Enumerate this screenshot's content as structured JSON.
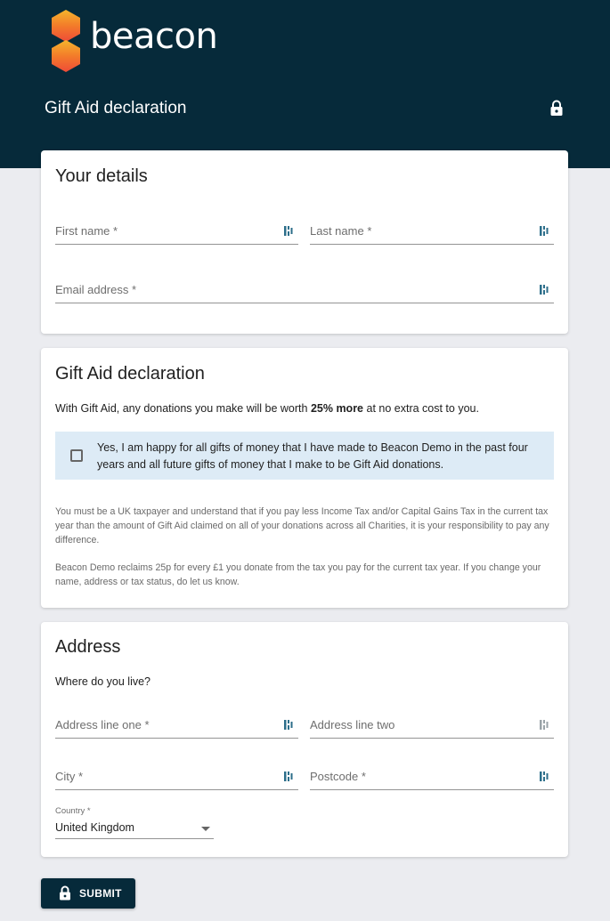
{
  "brand": {
    "name": "beacon",
    "logo_colors": [
      "#f5b52c",
      "#f37b2a",
      "#ee4b38"
    ]
  },
  "header": {
    "title": "Gift Aid declaration",
    "lock_icon": "lock-icon"
  },
  "your_details": {
    "title": "Your details",
    "first_name_label": "First name *",
    "last_name_label": "Last name *",
    "email_label": "Email address *"
  },
  "gift_aid": {
    "title": "Gift Aid declaration",
    "intro_before": "With Gift Aid, any donations you make will be worth ",
    "intro_bold": "25% more",
    "intro_after": " at no extra cost to you.",
    "consent_text": "Yes, I am happy for all gifts of money that I have made to Beacon Demo in the past four years and all future gifts of money that I make to be Gift Aid donations.",
    "consent_checked": false,
    "notice_1": "You must be a UK taxpayer and understand that if you pay less Income Tax and/or Capital Gains Tax in the current tax year than the amount of Gift Aid claimed on all of your donations across all Charities, it is your responsibility to pay any difference.",
    "notice_2": "Beacon Demo reclaims 25p for every £1 you donate from the tax you pay for the current tax year. If you change your name, address or tax status, do let us know."
  },
  "address": {
    "title": "Address",
    "subtitle": "Where do you live?",
    "line_one_label": "Address line one *",
    "line_two_label": "Address line two",
    "city_label": "City *",
    "postcode_label": "Postcode *",
    "country_label": "Country *",
    "country_value": "United Kingdom"
  },
  "submit": {
    "label": "SUBMIT",
    "icon": "lock-icon"
  },
  "colors": {
    "header_bg": "#062a3a",
    "page_bg": "#ebecf0",
    "consent_bg": "#ddebf6"
  }
}
